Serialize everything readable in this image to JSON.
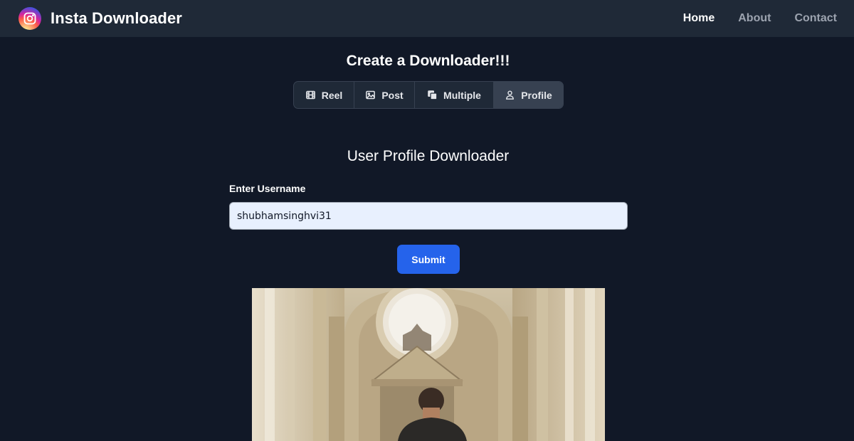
{
  "navbar": {
    "brand_title": "Insta Downloader",
    "links": [
      {
        "label": "Home",
        "active": true
      },
      {
        "label": "About",
        "active": false
      },
      {
        "label": "Contact",
        "active": false
      }
    ]
  },
  "main": {
    "heading": "Create a Downloader!!!",
    "tabs": [
      {
        "label": "Reel",
        "icon": "film-icon",
        "active": false
      },
      {
        "label": "Post",
        "icon": "image-icon",
        "active": false
      },
      {
        "label": "Multiple",
        "icon": "multiple-icon",
        "active": false
      },
      {
        "label": "Profile",
        "icon": "user-icon",
        "active": true
      }
    ],
    "subheading": "User Profile Downloader",
    "username_label": "Enter Username",
    "username_value": "shubhamsinghvi31",
    "submit_label": "Submit"
  },
  "colors": {
    "background": "#111827",
    "navbar": "#1f2937",
    "accent": "#2563eb",
    "tab_active": "#374151",
    "nav_inactive": "#9ca3af"
  }
}
